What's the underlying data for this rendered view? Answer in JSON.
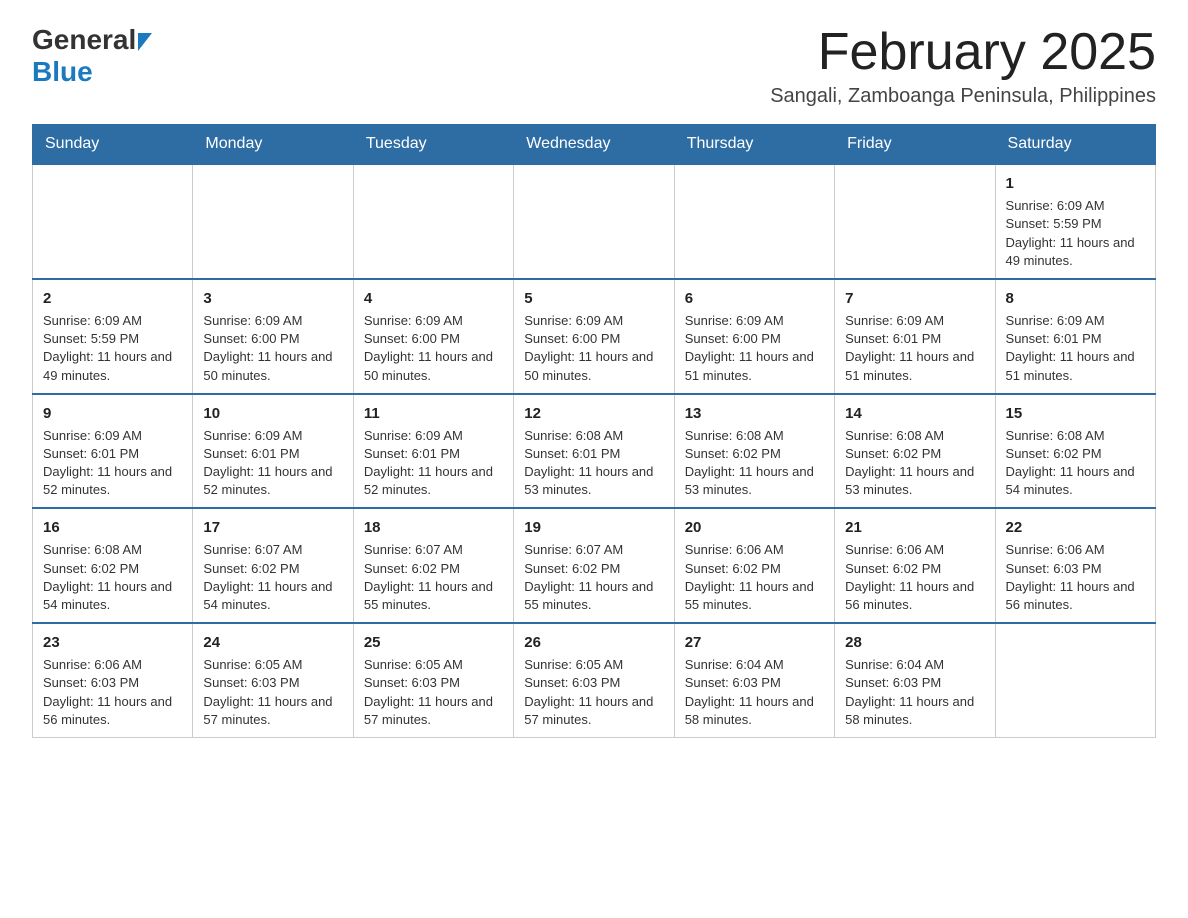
{
  "logo": {
    "general": "General",
    "blue": "Blue"
  },
  "header": {
    "month_year": "February 2025",
    "location": "Sangali, Zamboanga Peninsula, Philippines"
  },
  "days_of_week": [
    "Sunday",
    "Monday",
    "Tuesday",
    "Wednesday",
    "Thursday",
    "Friday",
    "Saturday"
  ],
  "weeks": [
    {
      "days": [
        {
          "number": "",
          "info": ""
        },
        {
          "number": "",
          "info": ""
        },
        {
          "number": "",
          "info": ""
        },
        {
          "number": "",
          "info": ""
        },
        {
          "number": "",
          "info": ""
        },
        {
          "number": "",
          "info": ""
        },
        {
          "number": "1",
          "info": "Sunrise: 6:09 AM\nSunset: 5:59 PM\nDaylight: 11 hours and 49 minutes."
        }
      ]
    },
    {
      "days": [
        {
          "number": "2",
          "info": "Sunrise: 6:09 AM\nSunset: 5:59 PM\nDaylight: 11 hours and 49 minutes."
        },
        {
          "number": "3",
          "info": "Sunrise: 6:09 AM\nSunset: 6:00 PM\nDaylight: 11 hours and 50 minutes."
        },
        {
          "number": "4",
          "info": "Sunrise: 6:09 AM\nSunset: 6:00 PM\nDaylight: 11 hours and 50 minutes."
        },
        {
          "number": "5",
          "info": "Sunrise: 6:09 AM\nSunset: 6:00 PM\nDaylight: 11 hours and 50 minutes."
        },
        {
          "number": "6",
          "info": "Sunrise: 6:09 AM\nSunset: 6:00 PM\nDaylight: 11 hours and 51 minutes."
        },
        {
          "number": "7",
          "info": "Sunrise: 6:09 AM\nSunset: 6:01 PM\nDaylight: 11 hours and 51 minutes."
        },
        {
          "number": "8",
          "info": "Sunrise: 6:09 AM\nSunset: 6:01 PM\nDaylight: 11 hours and 51 minutes."
        }
      ]
    },
    {
      "days": [
        {
          "number": "9",
          "info": "Sunrise: 6:09 AM\nSunset: 6:01 PM\nDaylight: 11 hours and 52 minutes."
        },
        {
          "number": "10",
          "info": "Sunrise: 6:09 AM\nSunset: 6:01 PM\nDaylight: 11 hours and 52 minutes."
        },
        {
          "number": "11",
          "info": "Sunrise: 6:09 AM\nSunset: 6:01 PM\nDaylight: 11 hours and 52 minutes."
        },
        {
          "number": "12",
          "info": "Sunrise: 6:08 AM\nSunset: 6:01 PM\nDaylight: 11 hours and 53 minutes."
        },
        {
          "number": "13",
          "info": "Sunrise: 6:08 AM\nSunset: 6:02 PM\nDaylight: 11 hours and 53 minutes."
        },
        {
          "number": "14",
          "info": "Sunrise: 6:08 AM\nSunset: 6:02 PM\nDaylight: 11 hours and 53 minutes."
        },
        {
          "number": "15",
          "info": "Sunrise: 6:08 AM\nSunset: 6:02 PM\nDaylight: 11 hours and 54 minutes."
        }
      ]
    },
    {
      "days": [
        {
          "number": "16",
          "info": "Sunrise: 6:08 AM\nSunset: 6:02 PM\nDaylight: 11 hours and 54 minutes."
        },
        {
          "number": "17",
          "info": "Sunrise: 6:07 AM\nSunset: 6:02 PM\nDaylight: 11 hours and 54 minutes."
        },
        {
          "number": "18",
          "info": "Sunrise: 6:07 AM\nSunset: 6:02 PM\nDaylight: 11 hours and 55 minutes."
        },
        {
          "number": "19",
          "info": "Sunrise: 6:07 AM\nSunset: 6:02 PM\nDaylight: 11 hours and 55 minutes."
        },
        {
          "number": "20",
          "info": "Sunrise: 6:06 AM\nSunset: 6:02 PM\nDaylight: 11 hours and 55 minutes."
        },
        {
          "number": "21",
          "info": "Sunrise: 6:06 AM\nSunset: 6:02 PM\nDaylight: 11 hours and 56 minutes."
        },
        {
          "number": "22",
          "info": "Sunrise: 6:06 AM\nSunset: 6:03 PM\nDaylight: 11 hours and 56 minutes."
        }
      ]
    },
    {
      "days": [
        {
          "number": "23",
          "info": "Sunrise: 6:06 AM\nSunset: 6:03 PM\nDaylight: 11 hours and 56 minutes."
        },
        {
          "number": "24",
          "info": "Sunrise: 6:05 AM\nSunset: 6:03 PM\nDaylight: 11 hours and 57 minutes."
        },
        {
          "number": "25",
          "info": "Sunrise: 6:05 AM\nSunset: 6:03 PM\nDaylight: 11 hours and 57 minutes."
        },
        {
          "number": "26",
          "info": "Sunrise: 6:05 AM\nSunset: 6:03 PM\nDaylight: 11 hours and 57 minutes."
        },
        {
          "number": "27",
          "info": "Sunrise: 6:04 AM\nSunset: 6:03 PM\nDaylight: 11 hours and 58 minutes."
        },
        {
          "number": "28",
          "info": "Sunrise: 6:04 AM\nSunset: 6:03 PM\nDaylight: 11 hours and 58 minutes."
        },
        {
          "number": "",
          "info": ""
        }
      ]
    }
  ]
}
